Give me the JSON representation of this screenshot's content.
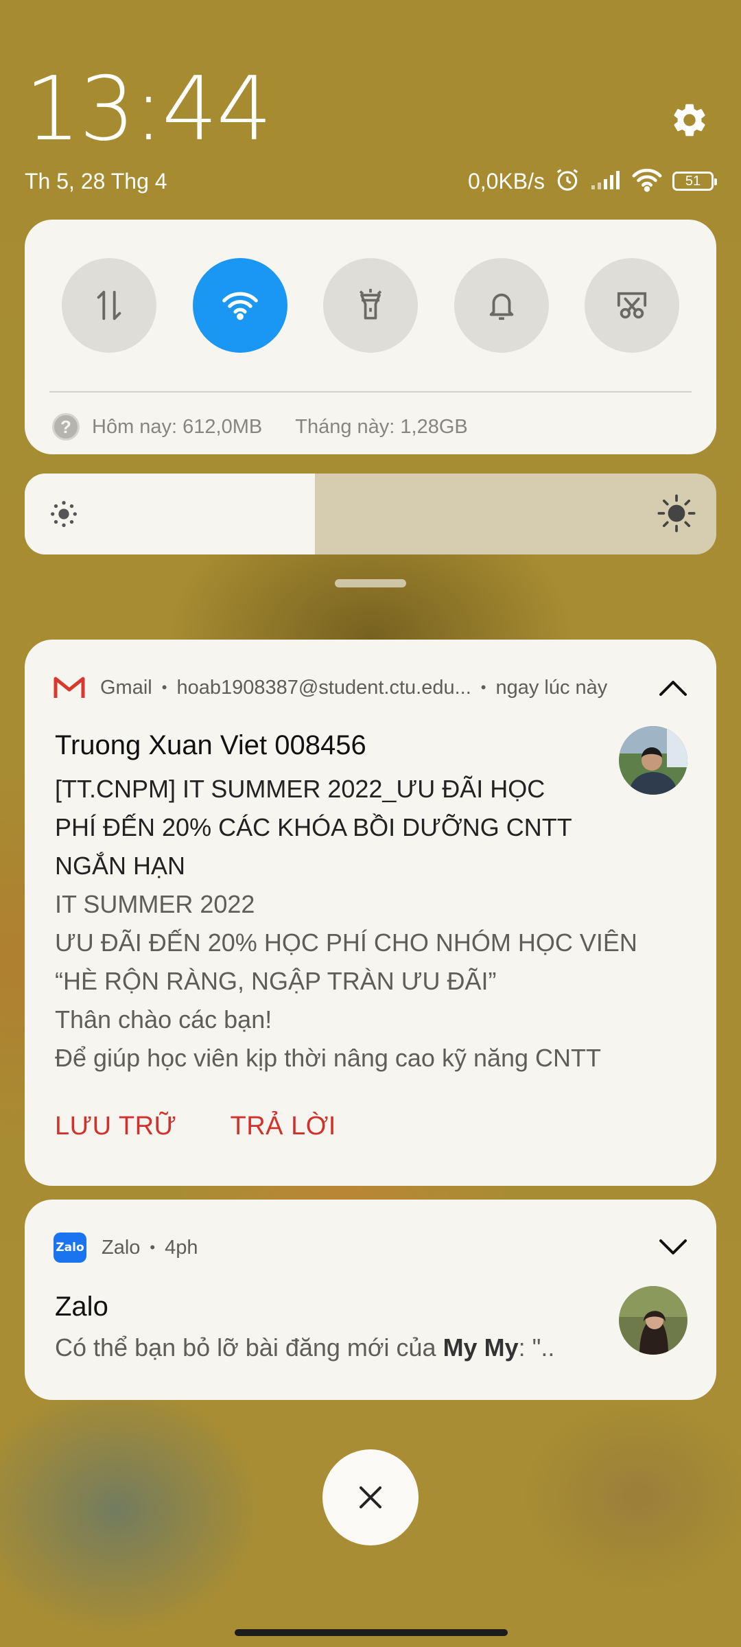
{
  "header": {
    "time": "13:44",
    "date": "Th 5, 28 Thg 4",
    "network_speed": "0,0KB/s",
    "battery_level": "51"
  },
  "quick_settings": {
    "toggles": [
      {
        "name": "mobile-data",
        "icon": "data-transfer-icon",
        "active": false
      },
      {
        "name": "wifi",
        "icon": "wifi-icon",
        "active": true
      },
      {
        "name": "flashlight",
        "icon": "flashlight-icon",
        "active": false
      },
      {
        "name": "sound",
        "icon": "bell-icon",
        "active": false
      },
      {
        "name": "screenshot",
        "icon": "scissors-icon",
        "active": false
      }
    ],
    "data_usage_today": "Hôm nay: 612,0MB",
    "data_usage_month": "Tháng này: 1,28GB",
    "active_color": "#1a97f3"
  },
  "brightness": {
    "level_fraction": 0.42
  },
  "notifications": {
    "gmail": {
      "app": "Gmail",
      "account": "hoab1908387@student.ctu.edu...",
      "time": "ngay lúc này",
      "sender": "Truong Xuan Viet 008456",
      "subject_lines": [
        "[TT.CNPM] IT SUMMER 2022_ƯU ĐÃI HỌC",
        "PHÍ ĐẾN 20% CÁC KHÓA BỒI DƯỠNG CNTT",
        "NGẮN HẠN"
      ],
      "snippet_lines": [
        "IT SUMMER 2022",
        "ƯU ĐÃI ĐẾN 20% HỌC PHÍ CHO NHÓM HỌC VIÊN",
        "“HÈ RỘN RÀNG, NGẬP TRÀN ƯU ĐÃI”",
        "Thân chào các bạn!",
        "Để giúp học viên kịp thời nâng cao kỹ năng CNTT"
      ],
      "actions": [
        "LƯU TRỮ",
        "TRẢ LỜI"
      ],
      "action_color": "#d2312b"
    },
    "zalo": {
      "app": "Zalo",
      "logo_text": "Zalo",
      "time": "4ph",
      "title": "Zalo",
      "body_prefix": "Có thể bạn bỏ lỡ bài đăng mới của ",
      "body_name": "My My",
      "body_suffix": ": \".."
    }
  }
}
